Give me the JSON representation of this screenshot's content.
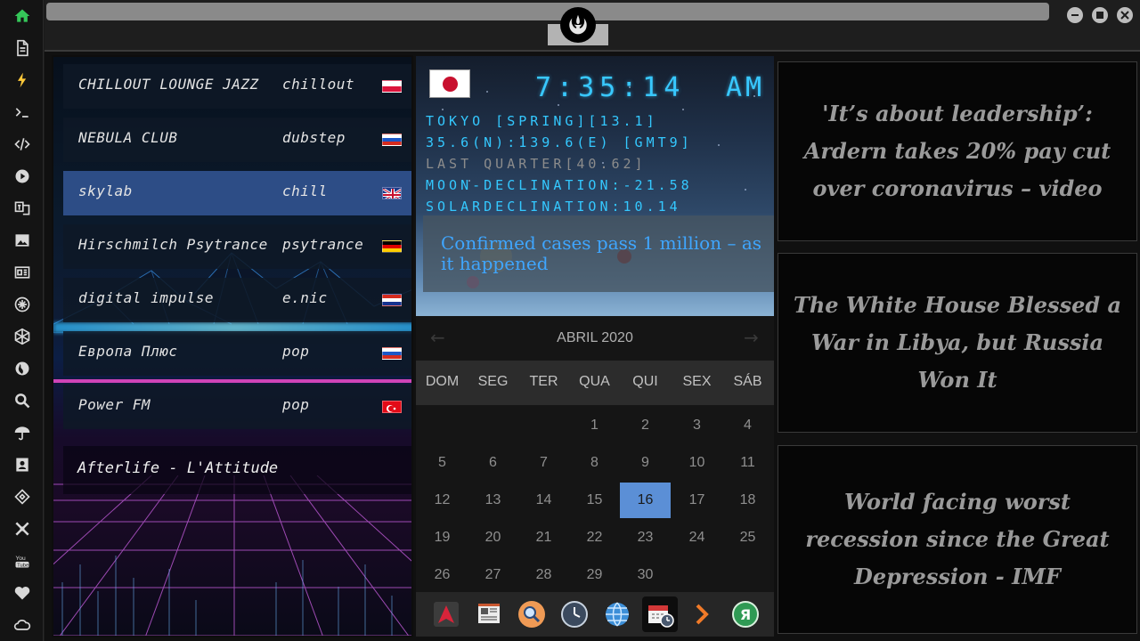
{
  "dock": {
    "icons": [
      "home-icon",
      "document-icon",
      "bolt-icon",
      "terminal-icon",
      "code-icon",
      "play-icon",
      "translate-icon",
      "image-icon",
      "news-icon",
      "settings-icon",
      "hexagon-icon",
      "globe-icon",
      "search-icon",
      "umbrella-icon",
      "contacts-icon",
      "dev-icon",
      "tools-icon",
      "youtube-icon",
      "heart-icon",
      "cloud-icon"
    ],
    "colors": {
      "home": "#35c759",
      "bolt": "#ffc93a"
    }
  },
  "radio": {
    "stations": [
      {
        "name": "CHILLOUT LOUNGE JAZZ",
        "genre": "chillout",
        "flag": "poland"
      },
      {
        "name": "NEBULA CLUB",
        "genre": "dubstep",
        "flag": "russia"
      },
      {
        "name": "skylab",
        "genre": "chill",
        "flag": "uk",
        "active": true
      },
      {
        "name": "Hirschmilch Psytrance",
        "genre": "psytrance",
        "flag": "germany"
      },
      {
        "name": "digital impulse",
        "genre": "e.nic",
        "flag": "croatia"
      },
      {
        "name": "Европа Плюс",
        "genre": "pop",
        "flag": "russia"
      },
      {
        "name": "Power FM",
        "genre": "pop",
        "flag": "turkey"
      }
    ],
    "now_playing": "Afterlife - L'Attitude",
    "active_color": "#2d4d86"
  },
  "clock": {
    "flag": "japan",
    "time": "7:35:14",
    "ampm": "AM",
    "lines": [
      "TOKYO [SPRING][13.1]",
      "35.6(N):139.6(E) [GMT9]",
      "LAST QUARTER[40.62]",
      "MOON-DECLINATION:-21.58",
      "SOLARDECLINATION:10.14"
    ],
    "overlay_headline": "Confirmed cases pass 1 million – as it happened",
    "lcd_color": "#38c8ff"
  },
  "calendar": {
    "month": "ABRIL 2020",
    "weekdays": [
      "DOM",
      "SEG",
      "TER",
      "QUA",
      "QUI",
      "SEX",
      "SÁB"
    ],
    "weeks": [
      [
        "",
        "",
        "",
        "1",
        "2",
        "3",
        "4"
      ],
      [
        "5",
        "6",
        "7",
        "8",
        "9",
        "10",
        "11"
      ],
      [
        "12",
        "13",
        "14",
        "15",
        "16",
        "17",
        "18"
      ],
      [
        "19",
        "20",
        "21",
        "22",
        "23",
        "24",
        "25"
      ],
      [
        "26",
        "27",
        "28",
        "29",
        "30",
        "",
        ""
      ]
    ],
    "today": "16",
    "today_color": "#5b8fd6"
  },
  "tray": {
    "apps": [
      "arch-app-icon",
      "newspaper-app-icon",
      "search-app-icon",
      "clock-app-icon",
      "globe-app-icon",
      "calendar-app-icon",
      "arrow-app-icon",
      "yandex-app-icon"
    ],
    "selected": "calendar-app-icon"
  },
  "news": [
    "'It’s about leadership’: Ardern takes 20% pay cut over coronavirus – video",
    "The White House Blessed a War in Libya, but Russia Won It",
    "World facing worst recession since the Great Depression - IMF"
  ]
}
